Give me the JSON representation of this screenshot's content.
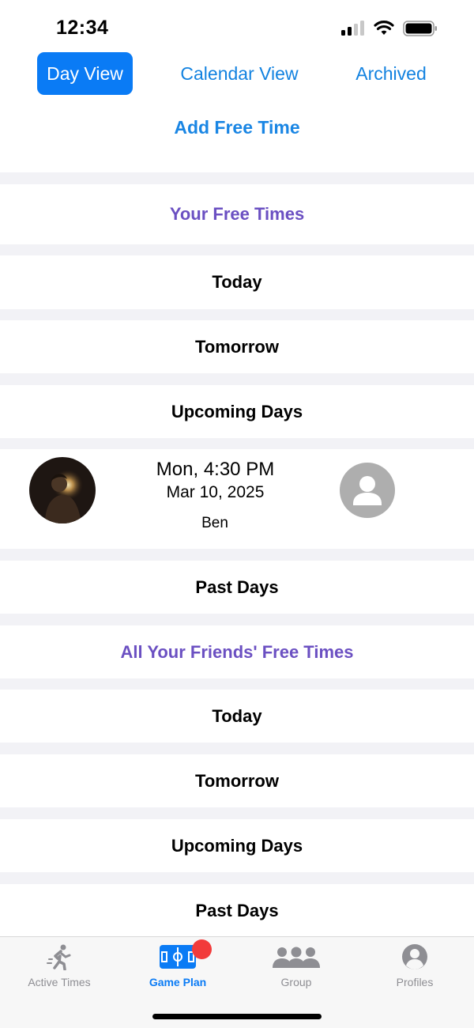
{
  "status_bar": {
    "time": "12:34"
  },
  "top_tabs": [
    {
      "label": "Day View",
      "active": true
    },
    {
      "label": "Calendar View",
      "active": false
    },
    {
      "label": "Archived",
      "active": false
    }
  ],
  "add_free_time": "Add Free Time",
  "sections": {
    "yours": {
      "title": "Your Free Times",
      "today": "Today",
      "tomorrow": "Tomorrow",
      "upcoming": "Upcoming Days",
      "past": "Past Days"
    },
    "friends": {
      "title": "All Your Friends' Free Times",
      "today": "Today",
      "tomorrow": "Tomorrow",
      "upcoming": "Upcoming Days",
      "past": "Past Days"
    }
  },
  "free_time_card": {
    "time": "Mon, 4:30 PM",
    "date": "Mar 10, 2025",
    "name": "Ben"
  },
  "tab_bar": [
    {
      "label": "Active Times",
      "icon": "running-figure-icon",
      "active": false
    },
    {
      "label": "Game Plan",
      "icon": "soccer-field-icon",
      "active": true,
      "badge": true
    },
    {
      "label": "Group",
      "icon": "group-icon",
      "active": false
    },
    {
      "label": "Profiles",
      "icon": "person-circle-icon",
      "active": false
    }
  ],
  "colors": {
    "accent_blue": "#0A7BF5",
    "link_blue": "#1A86E4",
    "section_purple": "#6B50C2",
    "badge_red": "#F23B3B",
    "separator_gray": "#F2F2F6"
  }
}
